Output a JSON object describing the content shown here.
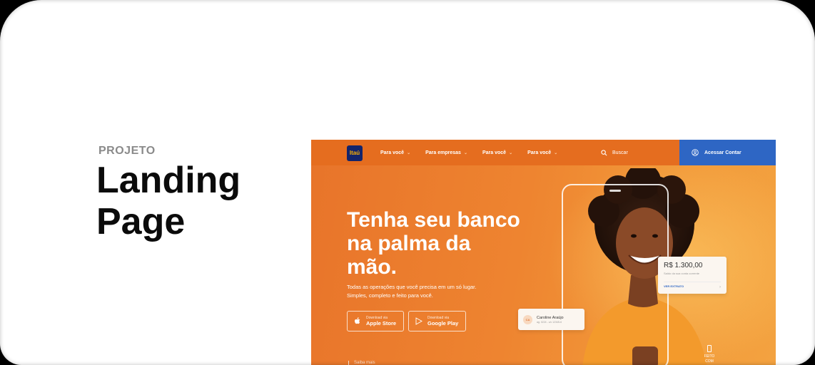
{
  "card": {
    "label": "PROJETO",
    "title": "Landing Page"
  },
  "mock": {
    "logo": "Itaú",
    "nav": [
      {
        "label": "Para você"
      },
      {
        "label": "Para empresas"
      },
      {
        "label": "Para você"
      },
      {
        "label": "Para você"
      }
    ],
    "search_label": "Buscar",
    "access_label": "Acessar Contar",
    "hero_title": "Tenha seu banco na palma da mão.",
    "hero_sub": "Todas as operações que você precisa em um só lugar. Simples, completo e feito para você.",
    "apple": {
      "small": "Download via",
      "big": "Apple Store"
    },
    "google": {
      "small": "Download via",
      "big": "Google Play"
    },
    "balance": {
      "amount": "R$ 1.300,00",
      "desc": "Saldo da sua conta corrente",
      "link": "VER EXTRATO"
    },
    "contact": {
      "initials": "CA",
      "name": "Caroline Araújo",
      "sub": "ag. 0224 - c/c 12345-6"
    },
    "feito": "FEITO COM",
    "bottom_text": "Saiba mais"
  },
  "colors": {
    "orange": "#ee8430",
    "topbar": "#e56d1f",
    "access_blue": "#2e66c4",
    "logo_navy": "#13246b"
  }
}
